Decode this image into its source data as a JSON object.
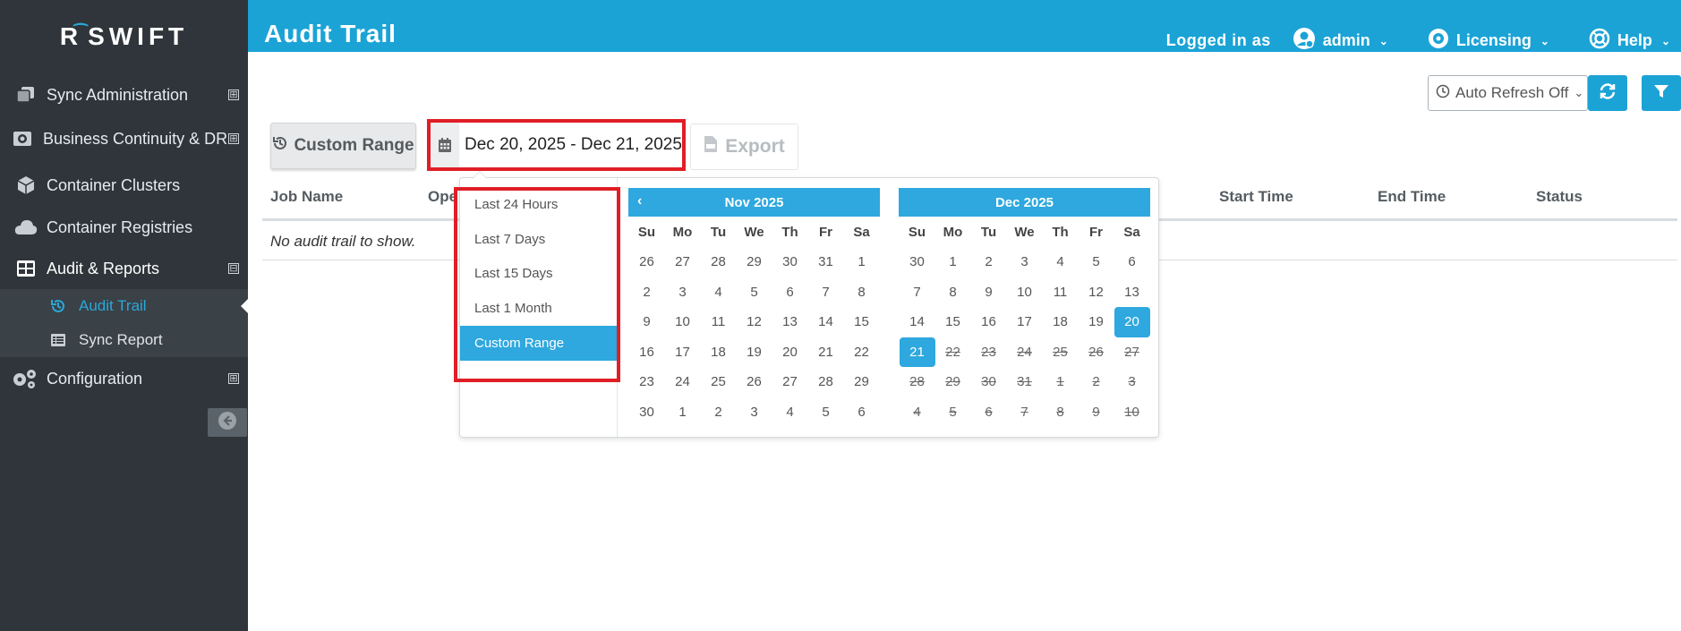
{
  "sidebar": {
    "logo_text": "SWIFT",
    "logo_mark": "R",
    "items": [
      {
        "label": "Sync Administration",
        "icon": "copy-icon",
        "expander": "⊞"
      },
      {
        "label": "Business Continuity & DR",
        "icon": "business-continuity-icon",
        "expander": "⊞"
      },
      {
        "label": "Container Clusters",
        "icon": "cube-icon"
      },
      {
        "label": "Container Registries",
        "icon": "cloud-icon"
      },
      {
        "label": "Audit & Reports",
        "icon": "table-icon",
        "expander": "⊟"
      },
      {
        "label": "Configuration",
        "icon": "cogs-icon",
        "expander": "⊞"
      }
    ],
    "sub_items": [
      {
        "label": "Audit Trail",
        "icon": "history-icon"
      },
      {
        "label": "Sync Report",
        "icon": "list-icon"
      }
    ]
  },
  "header": {
    "title": "Audit Trail",
    "logged_in_label": "Logged in as",
    "user": "admin",
    "licensing": "Licensing",
    "help": "Help"
  },
  "toolbar": {
    "auto_refresh": "Auto Refresh Off",
    "range_button": "Custom Range",
    "date_range": "Dec 20, 2025 - Dec 21, 2025",
    "export": "Export"
  },
  "table": {
    "columns": [
      "Job Name",
      "Ope",
      "Start Time",
      "End Time",
      "Status"
    ],
    "empty_message": "No audit trail to show."
  },
  "picker": {
    "ranges": [
      "Last 24 Hours",
      "Last 7 Days",
      "Last 15 Days",
      "Last 1 Month",
      "Custom Range"
    ],
    "active_range": "Custom Range",
    "days_of_week": [
      "Su",
      "Mo",
      "Tu",
      "We",
      "Th",
      "Fr",
      "Sa"
    ],
    "left_month": "Nov 2025",
    "right_month": "Dec 2025",
    "left_days": [
      "26",
      "27",
      "28",
      "29",
      "30",
      "31",
      "1",
      "2",
      "3",
      "4",
      "5",
      "6",
      "7",
      "8",
      "9",
      "10",
      "11",
      "12",
      "13",
      "14",
      "15",
      "16",
      "17",
      "18",
      "19",
      "20",
      "21",
      "22",
      "23",
      "24",
      "25",
      "26",
      "27",
      "28",
      "29",
      "30",
      "1",
      "2",
      "3",
      "4",
      "5",
      "6"
    ],
    "right_days": [
      "30",
      "1",
      "2",
      "3",
      "4",
      "5",
      "6",
      "7",
      "8",
      "9",
      "10",
      "11",
      "12",
      "13",
      "14",
      "15",
      "16",
      "17",
      "18",
      "19",
      "20",
      "21",
      "22",
      "23",
      "24",
      "25",
      "26",
      "27",
      "28",
      "29",
      "30",
      "31",
      "1",
      "2",
      "3",
      "4",
      "5",
      "6",
      "7",
      "8",
      "9",
      "10"
    ],
    "right_selected": [
      20,
      21
    ],
    "right_disabled_from_index": 22
  },
  "colors": {
    "sidebar_bg": "#2f353a",
    "header_bg": "#1ba3d6",
    "accent": "#2ea8de",
    "highlight_box": "#e01e26"
  }
}
